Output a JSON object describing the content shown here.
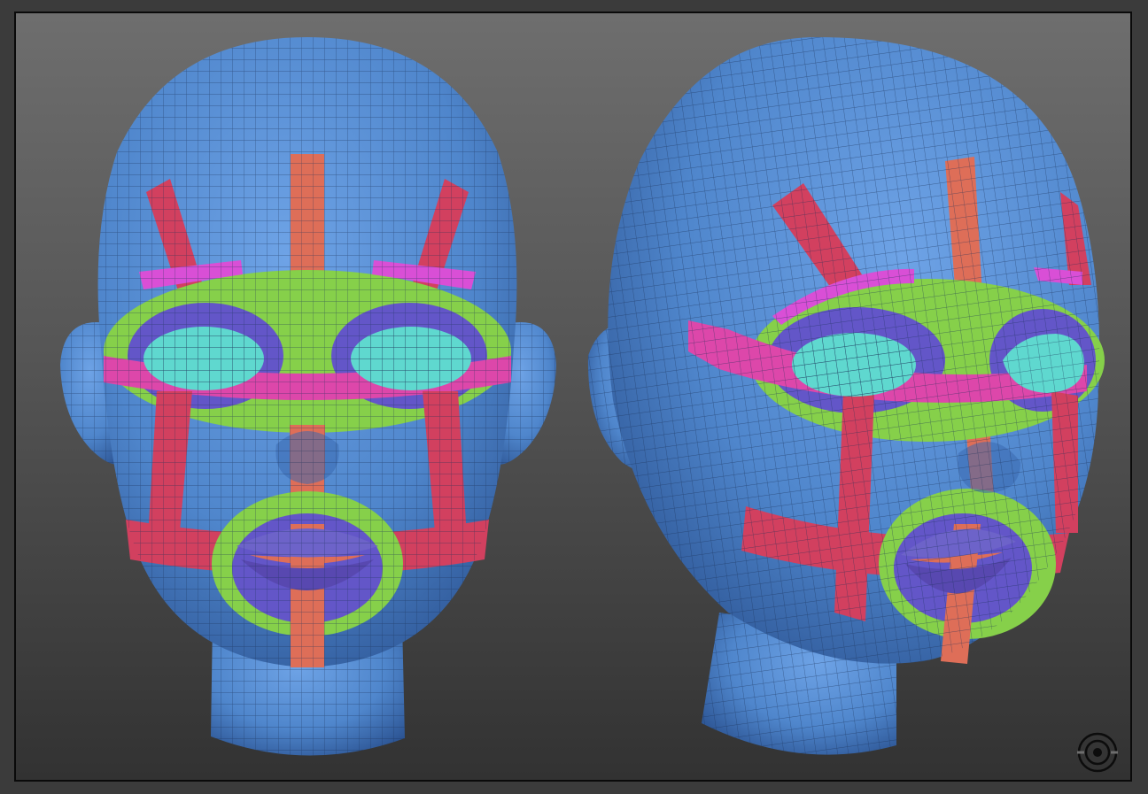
{
  "colors": {
    "mesh_base": "#4f86cc",
    "mesh_light": "#6ea3e6",
    "mesh_shadow": "#2c5493",
    "wire": "#1a2f55",
    "loop_red": "#d2405f",
    "loop_orange": "#de6e58",
    "loop_magenta": "#dd47aa",
    "loop_pink": "#d94fd6",
    "loop_green": "#86d04a",
    "loop_purple": "#6356c8",
    "eye": "#5fd8cf",
    "lip": "#6d63c9",
    "logo": "#0c0c0c"
  },
  "views": [
    {
      "name": "front-view",
      "icon": "head-front-icon"
    },
    {
      "name": "three-quarter-view",
      "icon": "head-three-quarter-icon"
    }
  ],
  "logo": {
    "icon": "target-logo-icon"
  }
}
